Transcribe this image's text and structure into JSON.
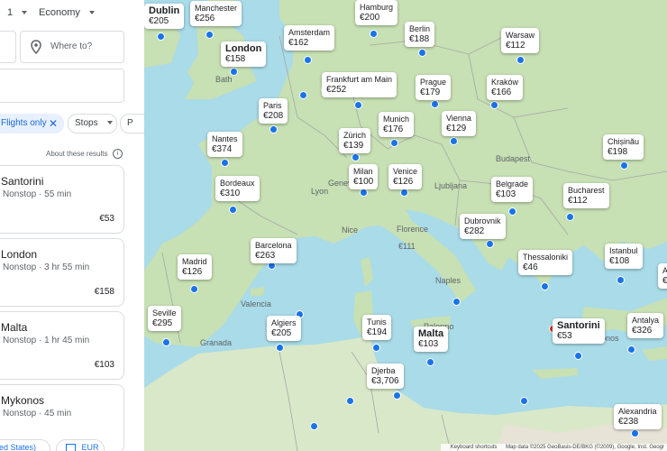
{
  "search": {
    "passengers": "1",
    "cabin_class": "Economy",
    "destination_placeholder": "Where to?"
  },
  "filters": {
    "nonstop_chip": "Flights only",
    "stops_chip": "Stops",
    "next_chip_partial": "P"
  },
  "results_note": "About these results",
  "results": [
    {
      "destination": "Santorini",
      "stops": "Nonstop",
      "duration": "55 min",
      "price": "€53"
    },
    {
      "destination": "London",
      "stops": "Nonstop",
      "duration": "3 hr 55 min",
      "price": "€158"
    },
    {
      "destination": "Malta",
      "stops": "Nonstop",
      "duration": "1 hr 45 min",
      "price": "€103"
    },
    {
      "destination": "Mykonos",
      "stops": "Nonstop",
      "duration": "45 min",
      "price": ""
    }
  ],
  "footer": {
    "region": "ed States)",
    "currency": "EUR"
  },
  "map_pins": [
    {
      "city": "Dublin",
      "price": "€205"
    },
    {
      "city": "Manchester",
      "price": "€256"
    },
    {
      "city": "Hamburg",
      "price": "€200"
    },
    {
      "city": "Amsterdam",
      "price": "€162"
    },
    {
      "city": "London",
      "price": "€158"
    },
    {
      "city": "Berlin",
      "price": "€188"
    },
    {
      "city": "Warsaw",
      "price": "€112"
    },
    {
      "city": "Frankfurt am Main",
      "price": "€252"
    },
    {
      "city": "Prague",
      "price": "€179"
    },
    {
      "city": "Kraków",
      "price": "€166"
    },
    {
      "city": "Paris",
      "price": "€208"
    },
    {
      "city": "Munich",
      "price": "€176"
    },
    {
      "city": "Vienna",
      "price": "€129"
    },
    {
      "city": "Zürich",
      "price": "€139"
    },
    {
      "city": "Nantes",
      "price": "€374"
    },
    {
      "city": "Chișinău",
      "price": "€198"
    },
    {
      "city": "Milan",
      "price": "€100"
    },
    {
      "city": "Venice",
      "price": "€126"
    },
    {
      "city": "Bordeaux",
      "price": "€310"
    },
    {
      "city": "Belgrade",
      "price": "€103"
    },
    {
      "city": "Bucharest",
      "price": "€112"
    },
    {
      "city": "Dubrovnik",
      "price": "€282"
    },
    {
      "city": "Barcelona",
      "price": "€263"
    },
    {
      "city": "Madrid",
      "price": "€126"
    },
    {
      "city": "Thessaloniki",
      "price": "€46"
    },
    {
      "city": "Istanbul",
      "price": "€108"
    },
    {
      "city": "A",
      "price": "€"
    },
    {
      "city": "Seville",
      "price": "€295"
    },
    {
      "city": "Algiers",
      "price": "€205"
    },
    {
      "city": "Tunis",
      "price": "€194"
    },
    {
      "city": "Santorini",
      "price": "€53"
    },
    {
      "city": "Antalya",
      "price": "€326"
    },
    {
      "city": "Malta",
      "price": "€103"
    },
    {
      "city": "Djerba",
      "price": "€3,706"
    },
    {
      "city": "Alexandria",
      "price": "€238"
    }
  ],
  "map_labels": {
    "bath": "Bath",
    "budapest": "Budapest",
    "ljubljana": "Ljubljana",
    "geneva": "Genev",
    "lyon": "Lyon",
    "nice": "Nice",
    "florence": "Florence",
    "florence_price": "€111",
    "naples": "Naples",
    "valencia": "Valencia",
    "granada": "Granada",
    "palermo": "Palermo",
    "mykonos_partial": "onos"
  },
  "attribution": {
    "shortcuts": "Keyboard shortcuts",
    "map_data": "Map data ©2025 GeoBasis-DE/BKG (©2009), Google, Inst. Geogr"
  },
  "colors": {
    "sea": "#a9dbe8",
    "land": "#c7e0b4",
    "accent": "#1a73e8",
    "selected": "#d93025"
  }
}
